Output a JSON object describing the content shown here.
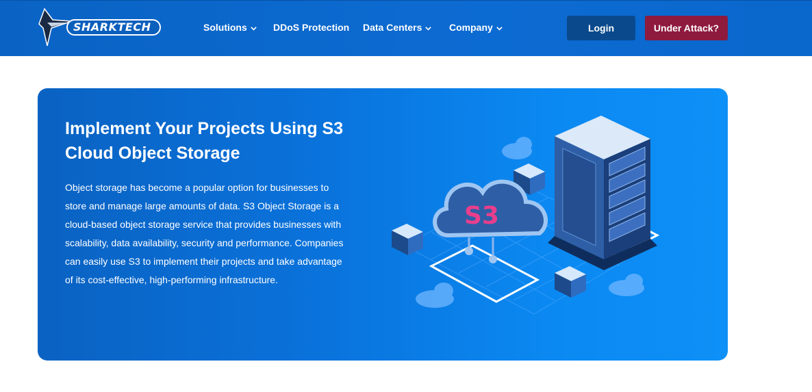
{
  "brand": {
    "logo_text": "SHARKTECH"
  },
  "nav": {
    "items": [
      {
        "label": "Solutions",
        "has_dropdown": true
      },
      {
        "label": "DDoS Protection",
        "has_dropdown": false
      },
      {
        "label": "Data Centers",
        "has_dropdown": true
      },
      {
        "label": "Company",
        "has_dropdown": true
      }
    ],
    "login_label": "Login",
    "attack_label": "Under Attack?"
  },
  "hero": {
    "title": "Implement Your Projects Using S3 Cloud Object Storage",
    "body": "Object storage has become a popular option for businesses to store and manage large amounts of data. S3 Object Storage is a cloud-based object storage service that provides businesses with scalability, data availability, security and performance. Companies can easily use S3 to implement their projects and take advantage of its cost-effective, high-performing infrastructure.",
    "illustration_label": "S3"
  },
  "colors": {
    "nav_bg": "#0c6bd2",
    "login_bg": "#0a4a8c",
    "attack_bg": "#8e1a3e",
    "hero_start": "#0a62c2",
    "hero_end": "#0d90f7",
    "accent_pink": "#e83e8c"
  }
}
